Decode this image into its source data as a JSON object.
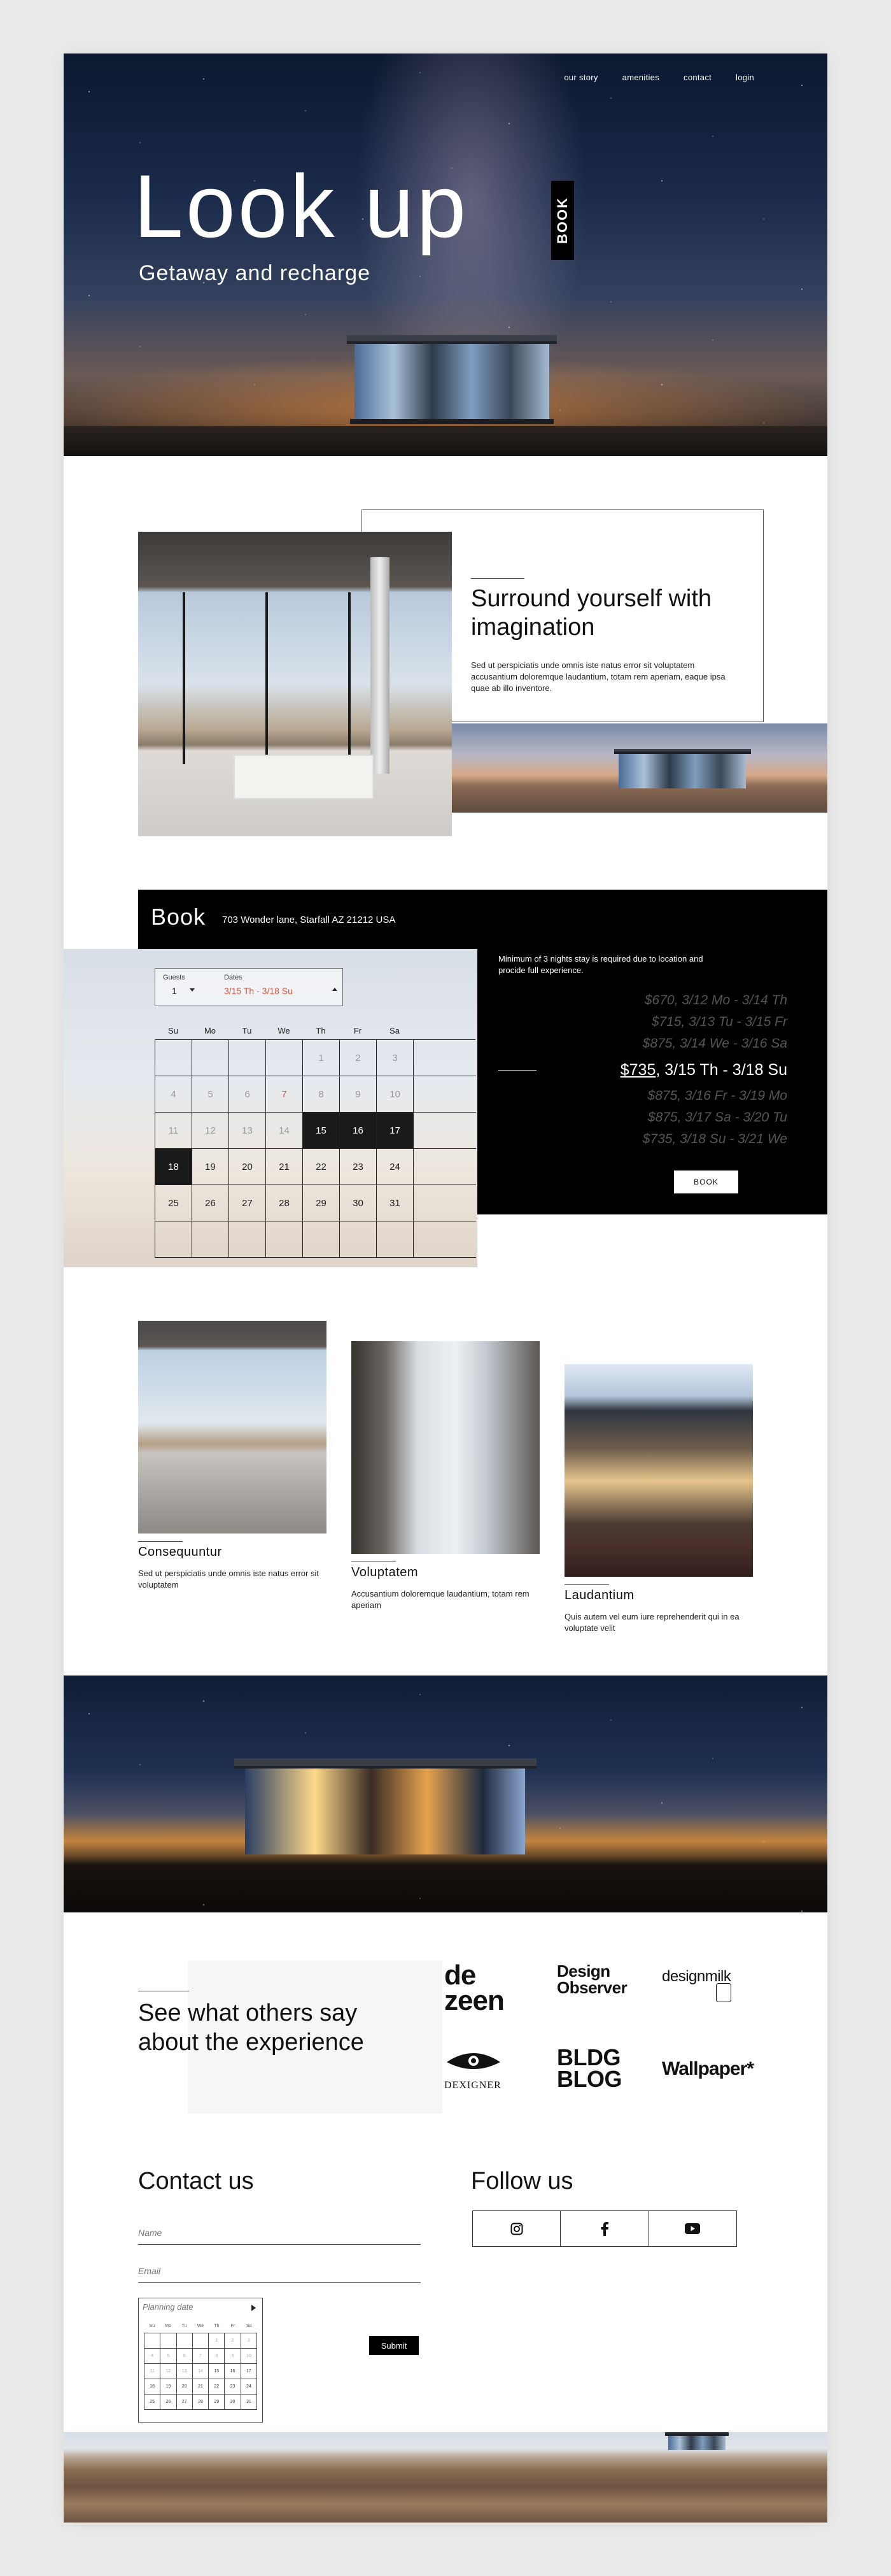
{
  "nav": {
    "items": [
      "our story",
      "amenities",
      "contact",
      "login"
    ]
  },
  "hero": {
    "title": "Look up",
    "subtitle": "Getaway and recharge",
    "book_tab": "BOOK"
  },
  "intro": {
    "title": "Surround yourself with imagination",
    "body": "Sed ut perspiciatis unde omnis iste natus error sit voluptatem accusantium doloremque laudantium, totam rem aperiam, eaque ipsa quae ab illo inventore."
  },
  "booking": {
    "title": "Book",
    "address": "703 Wonder lane, Starfall AZ 21212 USA",
    "guests_label": "Guests",
    "guests_value": "1",
    "dates_label": "Dates",
    "dates_value": "3/15 Th - 3/18 Su",
    "weekdays": [
      "Su",
      "Mo",
      "Tu",
      "We",
      "Th",
      "Fr",
      "Sa"
    ],
    "weeks": [
      [
        "",
        "",
        "",
        "",
        "1",
        "2",
        "3"
      ],
      [
        "4",
        "5",
        "6",
        "7",
        "8",
        "9",
        "10"
      ],
      [
        "11",
        "12",
        "13",
        "14",
        "15",
        "16",
        "17"
      ],
      [
        "18",
        "19",
        "20",
        "21",
        "22",
        "23",
        "24"
      ],
      [
        "25",
        "26",
        "27",
        "28",
        "29",
        "30",
        "31"
      ],
      [
        "",
        "",
        "",
        "",
        "",
        "",
        ""
      ]
    ],
    "past_days": [
      "1",
      "2",
      "3",
      "4",
      "5",
      "6",
      "8",
      "9",
      "10",
      "11",
      "12",
      "13",
      "14"
    ],
    "highlight_day": "7",
    "selected_days": [
      "15",
      "16",
      "17",
      "18"
    ],
    "min_stay_note": "Minimum of 3 nights stay is required due to location and procide full experience.",
    "rates": [
      {
        "price": "$670",
        "range": "3/12 Mo - 3/14 Th"
      },
      {
        "price": "$715",
        "range": "3/13 Tu - 3/15 Fr"
      },
      {
        "price": "$875",
        "range": "3/14 We - 3/16 Sa"
      },
      {
        "price": "$735",
        "range": "3/15 Th - 3/18 Su"
      },
      {
        "price": "$875",
        "range": "3/16 Fr - 3/19 Mo"
      },
      {
        "price": "$875",
        "range": "3/17 Sa - 3/20 Tu"
      },
      {
        "price": "$735",
        "range": "3/18 Su - 3/21 We"
      }
    ],
    "active_rate_index": 3,
    "book_button": "BOOK"
  },
  "rooms": [
    {
      "title": "Consequuntur",
      "body": "Sed ut perspiciatis unde omnis iste natus error sit voluptatem"
    },
    {
      "title": "Voluptatem",
      "body": "Accusantium doloremque laudantium, totam rem aperiam"
    },
    {
      "title": "Laudantium",
      "body": "Quis autem vel eum iure reprehenderit qui in ea voluptate velit"
    }
  ],
  "press": {
    "title": "See what others say about the experience",
    "logos": {
      "dezeen_1": "de",
      "dezeen_2": "zeen",
      "design_observer_1": "Design",
      "design_observer_2": "Observer",
      "designmilk": "designmilk",
      "designer": "DEXIGNER",
      "bldg_1": "BLDG",
      "bldg_2": "BLOG",
      "wallpaper": "Wallpaper*"
    }
  },
  "contact": {
    "title": "Contact us",
    "name_placeholder": "Name",
    "email_placeholder": "Email",
    "planning_label": "Planning date",
    "mini_weekdays": [
      "Su",
      "Mo",
      "Tu",
      "We",
      "Th",
      "Fr",
      "Sa"
    ],
    "mini_weeks": [
      [
        "",
        "",
        "",
        "",
        "1",
        "2",
        "3"
      ],
      [
        "4",
        "5",
        "6",
        "7",
        "8",
        "9",
        "10"
      ],
      [
        "11",
        "12",
        "13",
        "14",
        "15",
        "16",
        "17"
      ],
      [
        "18",
        "19",
        "20",
        "21",
        "22",
        "23",
        "24"
      ],
      [
        "25",
        "26",
        "27",
        "28",
        "29",
        "30",
        "31"
      ]
    ],
    "submit": "Submit"
  },
  "follow": {
    "title": "Follow us",
    "icons": [
      "instagram-icon",
      "facebook-icon",
      "youtube-icon"
    ]
  }
}
